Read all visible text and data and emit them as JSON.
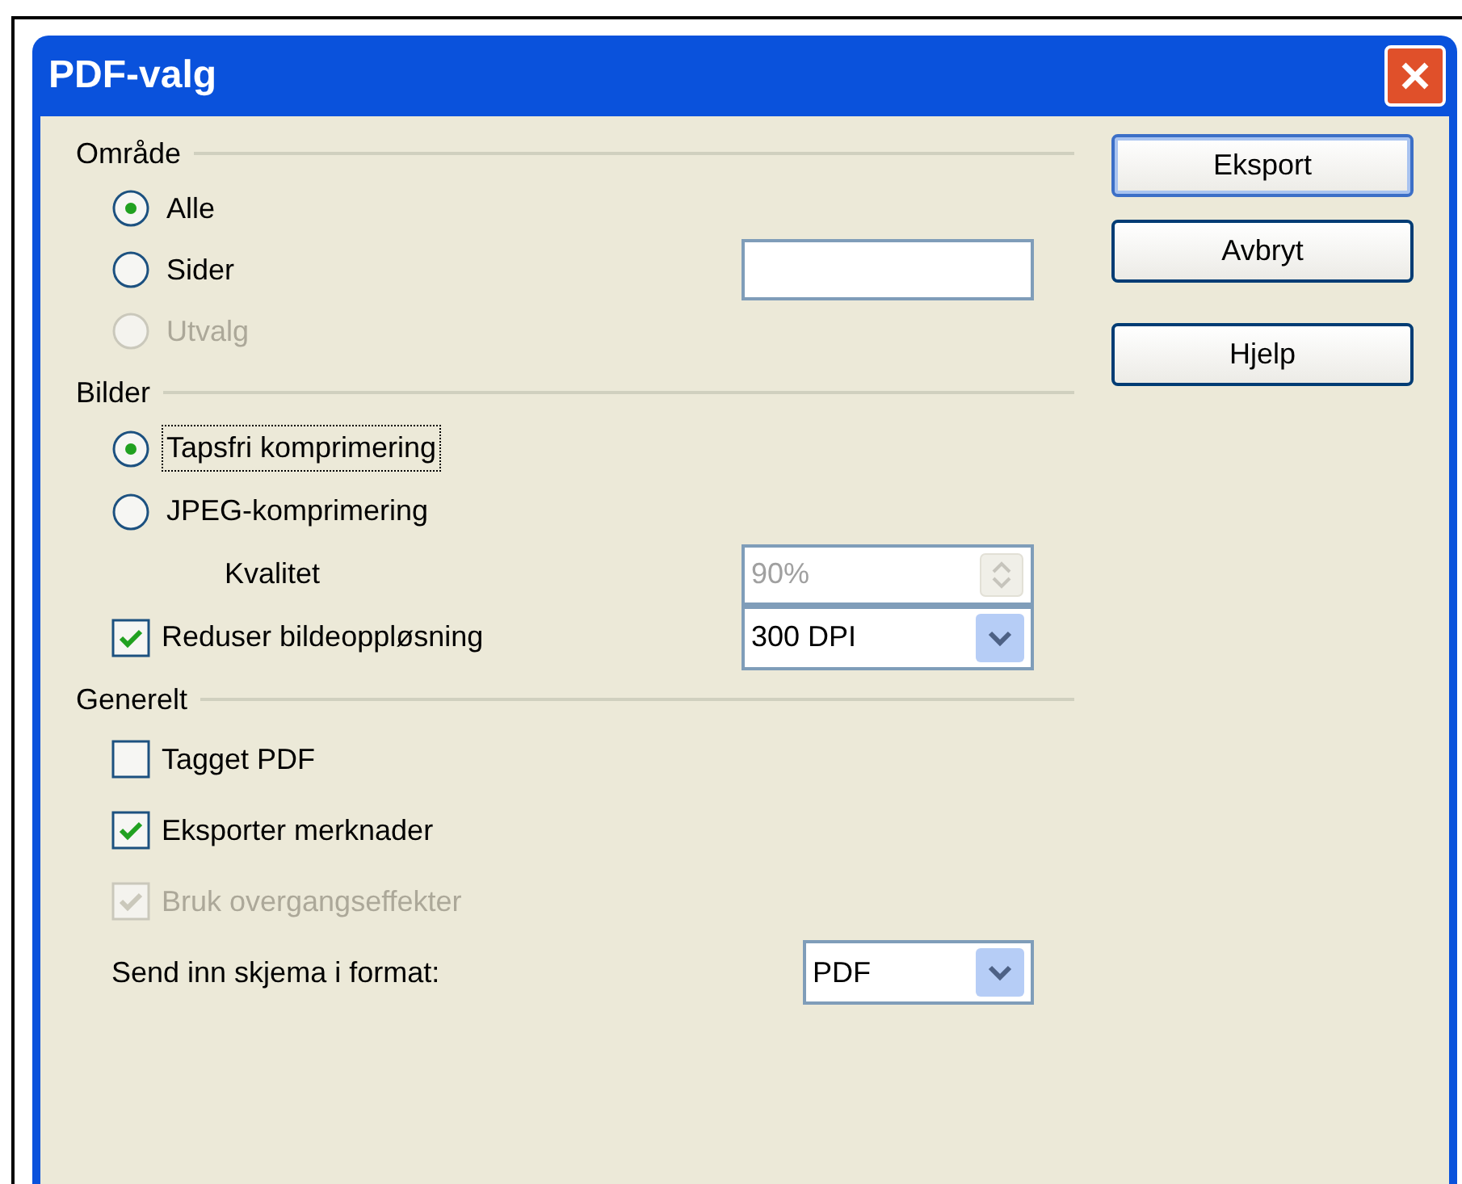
{
  "window": {
    "title": "PDF-valg"
  },
  "sections": [
    {
      "label": "Område",
      "rows": [
        {
          "kind": "radio",
          "label": "Alle",
          "selected": true,
          "disabled": false,
          "focused": false
        },
        {
          "kind": "radio",
          "label": "Sider",
          "selected": false,
          "disabled": false,
          "focused": false,
          "field": {
            "kind": "text"
          }
        },
        {
          "kind": "radio",
          "label": "Utvalg",
          "selected": false,
          "disabled": true,
          "focused": false
        }
      ]
    },
    {
      "label": "Bilder",
      "rows": [
        {
          "kind": "radio",
          "label": "Tapsfri komprimering",
          "selected": true,
          "disabled": false,
          "focused": true
        },
        {
          "kind": "radio",
          "label": "JPEG-komprimering",
          "selected": false,
          "disabled": false,
          "focused": false
        },
        {
          "kind": "label",
          "label": "Kvalitet",
          "indent": true,
          "field": {
            "kind": "spinner",
            "value": "90%",
            "disabled": true
          }
        },
        {
          "kind": "checkbox",
          "label": "Reduser bildeoppløsning",
          "checked": true,
          "disabled": false,
          "field": {
            "kind": "dropdown",
            "value": "300 DPI"
          }
        }
      ]
    },
    {
      "label": "Generelt",
      "rows": [
        {
          "kind": "checkbox",
          "label": "Tagget PDF",
          "checked": false,
          "disabled": false
        },
        {
          "kind": "checkbox",
          "label": "Eksporter merknader",
          "checked": true,
          "disabled": false
        },
        {
          "kind": "checkbox",
          "label": "Bruk overgangseffekter",
          "checked": true,
          "disabled": true
        },
        {
          "kind": "label",
          "label": "Send inn skjema i format:",
          "indent": false,
          "field": {
            "kind": "dropdown",
            "value": "PDF"
          }
        }
      ]
    }
  ],
  "buttons": [
    {
      "label": "Eksport",
      "default": true
    },
    {
      "label": "Avbryt",
      "default": false
    },
    {
      "label": "Hjelp",
      "default": false
    }
  ]
}
